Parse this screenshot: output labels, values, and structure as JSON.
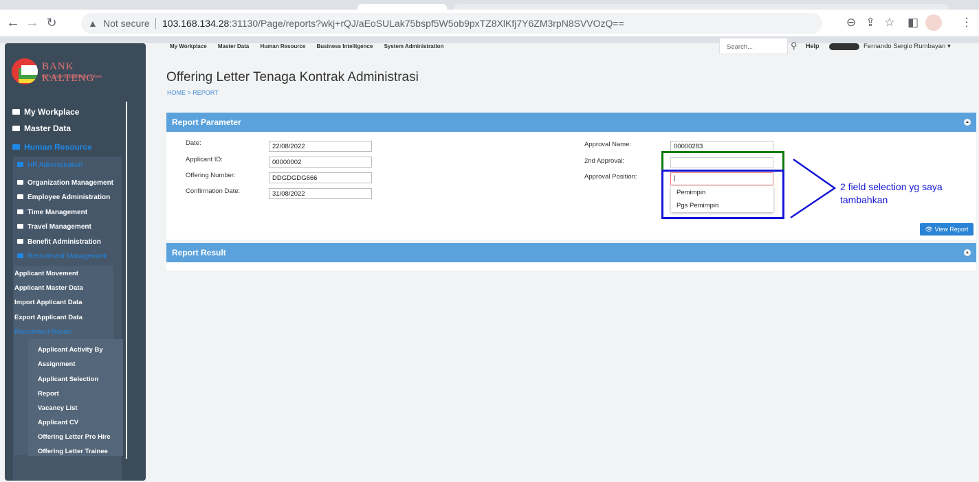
{
  "browser": {
    "security_label": "Not secure",
    "url_host": "103.168.134.28",
    "url_path": ":31130/Page/reports?wkj+rQJ/aEoSULak75bspf5W5ob9pxTZ8XlKfj7Y6ZM3rpN8SVVOzQ=="
  },
  "logo": {
    "name": "BANK KALTENG",
    "tagline": "Mitra Terpercaya Menuju Sukses"
  },
  "sidebar": {
    "top": [
      "My Workplace",
      "Master Data",
      "Human Resource"
    ],
    "hr_admin": "HR Administration",
    "level2": [
      "Organization Management",
      "Employee Administration",
      "Time Management",
      "Travel Management",
      "Benefit Administration",
      "Recruitment Management"
    ],
    "level3": [
      "Applicant Movement",
      "Applicant Master Data",
      "Import Applicant Data",
      "Export Applicant Data",
      "Recruitment Report"
    ],
    "level4": [
      "Applicant Activity By",
      "Assignment",
      "Applicant Selection",
      "Report",
      "Vacancy List",
      "Applicant CV",
      "Offering Letter Pro Hire",
      "Offering Letter Trainee"
    ]
  },
  "topnav": [
    "My Workplace",
    "Master Data",
    "Human Resource",
    "Business Intelligence",
    "System Administration"
  ],
  "header": {
    "search_placeholder": "Search...",
    "help": "Help",
    "user": "Fernando Sergio Rumbayan ▾"
  },
  "page": {
    "title": "Offering Letter Tenaga Kontrak Administrasi",
    "breadcrumb": "HOME > REPORT"
  },
  "report_parameter": {
    "title": "Report Parameter",
    "date_label": "Date:",
    "date_value": "22/08/2022",
    "applicant_label": "Applicant ID:",
    "applicant_value": "00000002",
    "offering_label": "Offering Number:",
    "offering_value": "DDGDGDG666",
    "confirm_label": "Confirmation Date:",
    "confirm_value": "31/08/2022",
    "approval_name_label": "Approval Name:",
    "approval_name_value": "00000283",
    "second_approval_label": "2nd Approval:",
    "second_approval_value": "",
    "approval_position_label": "Approval Position:",
    "approval_position_value": "|",
    "options": [
      "Pemimpin",
      "Pgs Pemimpin"
    ],
    "view_button": "View Report"
  },
  "report_result": {
    "title": "Report Result"
  },
  "annotation": {
    "text": "2 field selection yg saya tambahkan"
  }
}
